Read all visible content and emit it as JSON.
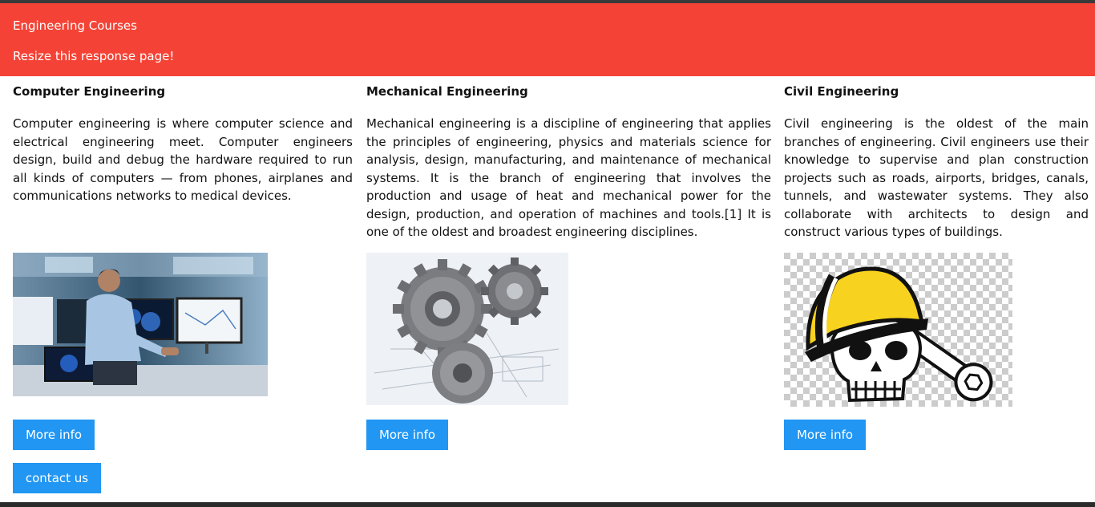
{
  "header": {
    "title": "Engineering Courses",
    "subtitle": "Resize this response page!"
  },
  "courses": [
    {
      "heading": "Computer Engineering",
      "text": "Computer engineering is where computer science and electrical engineering meet. Computer engineers design, build and debug the hardware required to run all kinds of computers — from phones, airplanes and communications networks to medical devices.",
      "button": "More info",
      "image": "computer-engineer-workstation-image"
    },
    {
      "heading": "Mechanical Engineering",
      "text": "Mechanical engineering is a discipline of engineering that applies the principles of engineering, physics and materials science for analysis, design, manufacturing, and maintenance of mechanical systems. It is the branch of engineering that involves the production and usage of heat and mechanical power for the design, production, and operation of machines and tools.[1] It is one of the oldest and broadest engineering disciplines.",
      "button": "More info",
      "image": "gears-on-blueprint-image"
    },
    {
      "heading": "Civil Engineering",
      "text": "Civil engineering is the oldest of the main branches of engineering. Civil engineers use their knowledge to supervise and plan construction projects such as roads, airports, bridges, canals, tunnels, and wastewater systems. They also collaborate with architects to design and construct various types of buildings.",
      "button": "More info",
      "image": "hardhat-skull-wrench-image"
    }
  ],
  "contact_button": "contact us",
  "colors": {
    "header_bg": "#f44336",
    "button_bg": "#2196f3"
  }
}
